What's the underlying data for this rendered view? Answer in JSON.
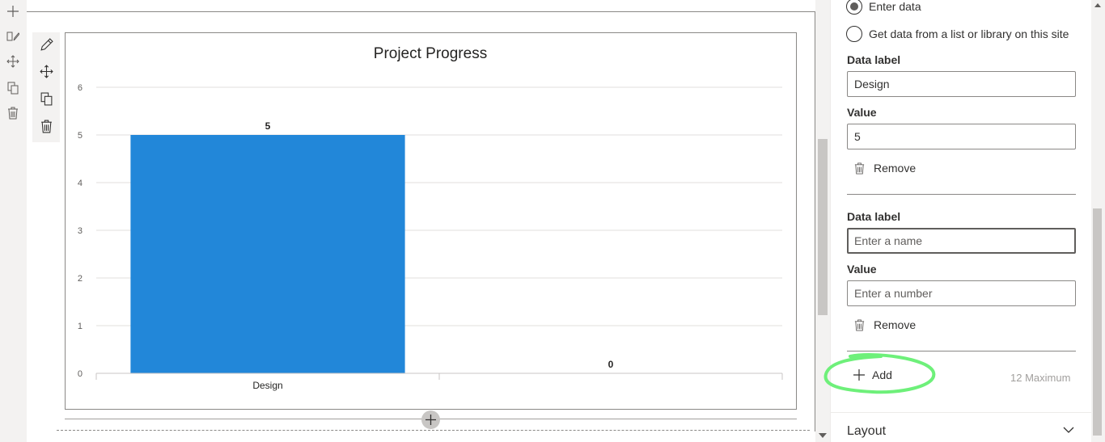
{
  "rail": {
    "items": [
      {
        "name": "add-icon"
      },
      {
        "name": "edit-section-icon"
      },
      {
        "name": "move-icon"
      },
      {
        "name": "duplicate-icon"
      },
      {
        "name": "delete-icon"
      }
    ]
  },
  "webpart_toolbar": {
    "items": [
      {
        "name": "pencil-icon"
      },
      {
        "name": "move-icon"
      },
      {
        "name": "duplicate-icon"
      },
      {
        "name": "delete-icon"
      }
    ]
  },
  "chart_data": {
    "type": "bar",
    "title": "Project Progress",
    "categories": [
      "Design",
      ""
    ],
    "values": [
      5,
      0
    ],
    "data_labels": [
      "5",
      "0"
    ],
    "ylim": [
      0,
      6
    ],
    "yticks": [
      "0",
      "1",
      "2",
      "3",
      "4",
      "5",
      "6"
    ],
    "grid": true,
    "bar_color": "#2287d9"
  },
  "pane": {
    "source_options": [
      {
        "label": "Enter data",
        "checked": true
      },
      {
        "label": "Get data from a list or library on this site",
        "checked": false
      }
    ],
    "entries": [
      {
        "label_title": "Data label",
        "label_value": "Design",
        "label_placeholder": "",
        "value_title": "Value",
        "value_value": "5",
        "value_placeholder": "",
        "remove_label": "Remove"
      },
      {
        "label_title": "Data label",
        "label_value": "",
        "label_placeholder": "Enter a name",
        "value_title": "Value",
        "value_value": "",
        "value_placeholder": "Enter a number",
        "remove_label": "Remove"
      }
    ],
    "add_label": "Add",
    "max_text": "12 Maximum",
    "layout_label": "Layout"
  },
  "colors": {
    "accent_bar": "#2287d9",
    "highlight": "#6ef07a"
  }
}
